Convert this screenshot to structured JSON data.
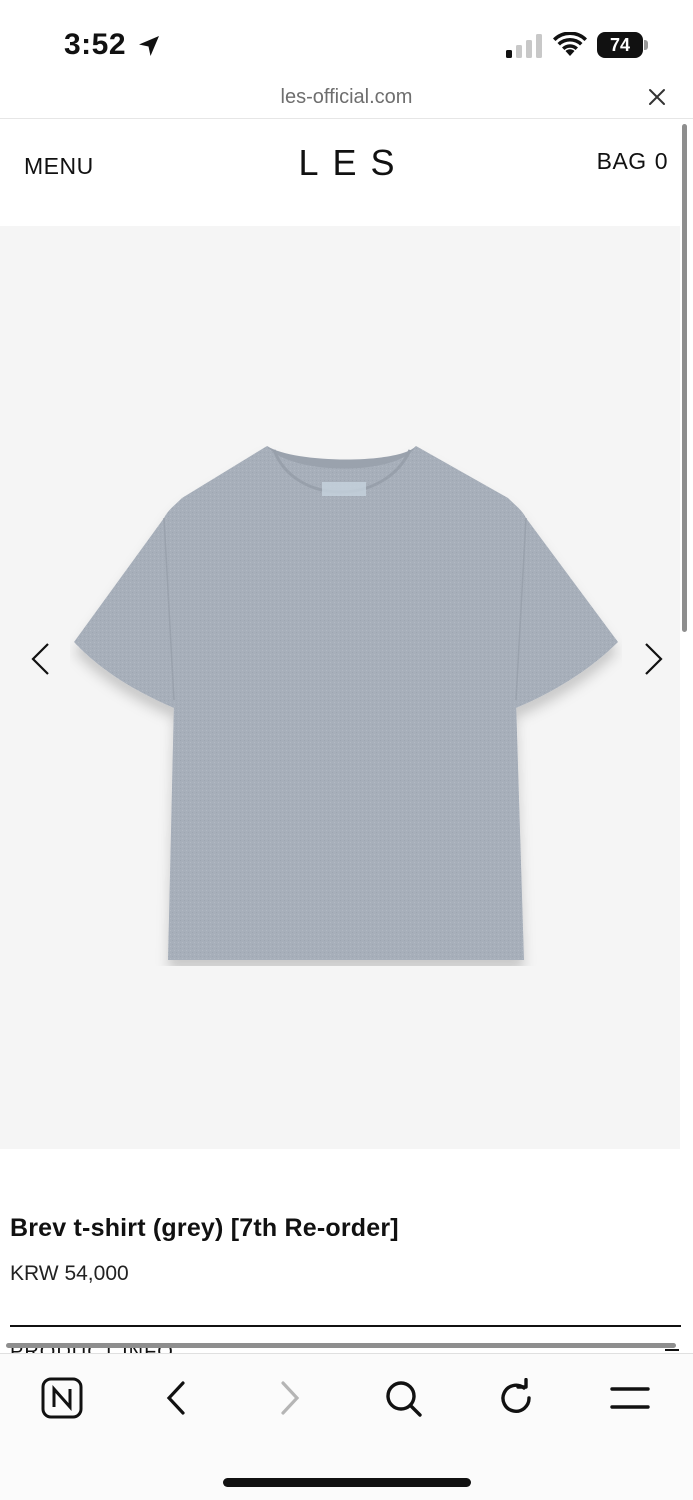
{
  "status_bar": {
    "time": "3:52",
    "battery": "74",
    "icons": [
      "location-arrow-icon",
      "cellular-signal-icon",
      "wifi-icon",
      "battery-icon"
    ]
  },
  "browser": {
    "url": "les-official.com",
    "close_icon": "close-icon"
  },
  "header": {
    "menu_label": "MENU",
    "logo": "LES",
    "bag_label": "BAG",
    "bag_count": "0"
  },
  "gallery": {
    "image": "grey-tshirt-product-photo",
    "prev_icon": "chevron-left-icon",
    "next_icon": "chevron-right-icon",
    "background": "#f5f5f5"
  },
  "product": {
    "title": "Brev t-shirt (grey) [7th Re-order]",
    "price": "KRW 54,000",
    "section_peek": "PRODUCT INFO"
  },
  "toolbar": {
    "items": [
      "naver-home-icon",
      "back-icon",
      "forward-icon",
      "search-icon",
      "reload-icon",
      "hamburger-menu-icon"
    ]
  },
  "colors": {
    "shirt": "#a7afba",
    "text": "#111111",
    "muted": "#6e6e6e"
  }
}
